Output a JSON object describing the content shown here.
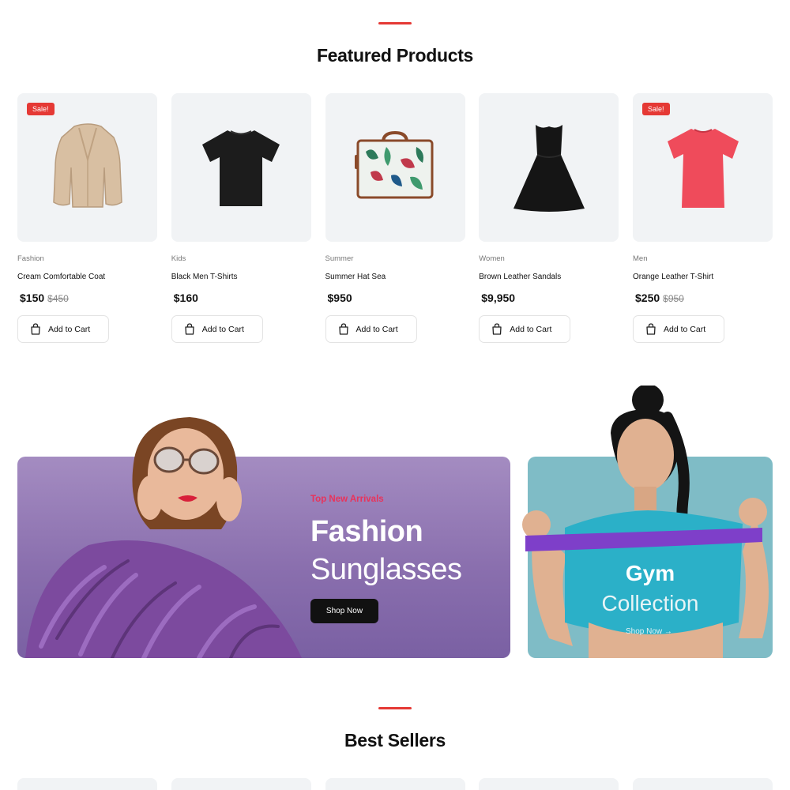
{
  "featured": {
    "title": "Featured Products",
    "products": [
      {
        "category": "Fashion",
        "name": "Cream Comfortable Coat",
        "price": "$150",
        "old_price": "$450",
        "badge": "Sale!",
        "icon": "coat-image"
      },
      {
        "category": "Kids",
        "name": "Black Men T-Shirts",
        "price": "$160",
        "old_price": "",
        "badge": "",
        "icon": "tshirt-image"
      },
      {
        "category": "Summer",
        "name": "Summer Hat Sea",
        "price": "$950",
        "old_price": "",
        "badge": "",
        "icon": "suitcase-image"
      },
      {
        "category": "Women",
        "name": "Brown Leather Sandals",
        "price": "$9,950",
        "old_price": "",
        "badge": "",
        "icon": "dress-image"
      },
      {
        "category": "Men",
        "name": "Orange Leather T-Shirt",
        "price": "$250",
        "old_price": "$950",
        "badge": "Sale!",
        "icon": "tshirt-image"
      }
    ],
    "add_to_cart_label": "Add to Cart"
  },
  "banner_fashion": {
    "eyebrow": "Top New Arrivals",
    "title": "Fashion",
    "subtitle": "Sunglasses",
    "button": "Shop Now"
  },
  "banner_gym": {
    "title": "Gym",
    "subtitle": "Collection",
    "link": "Shop Now →"
  },
  "best_sellers": {
    "title": "Best Sellers"
  },
  "colors": {
    "accent": "#e53935",
    "banner_purple": "#8a6fae",
    "banner_teal": "#7fbcc6",
    "eyebrow_pink": "#e8335b"
  }
}
